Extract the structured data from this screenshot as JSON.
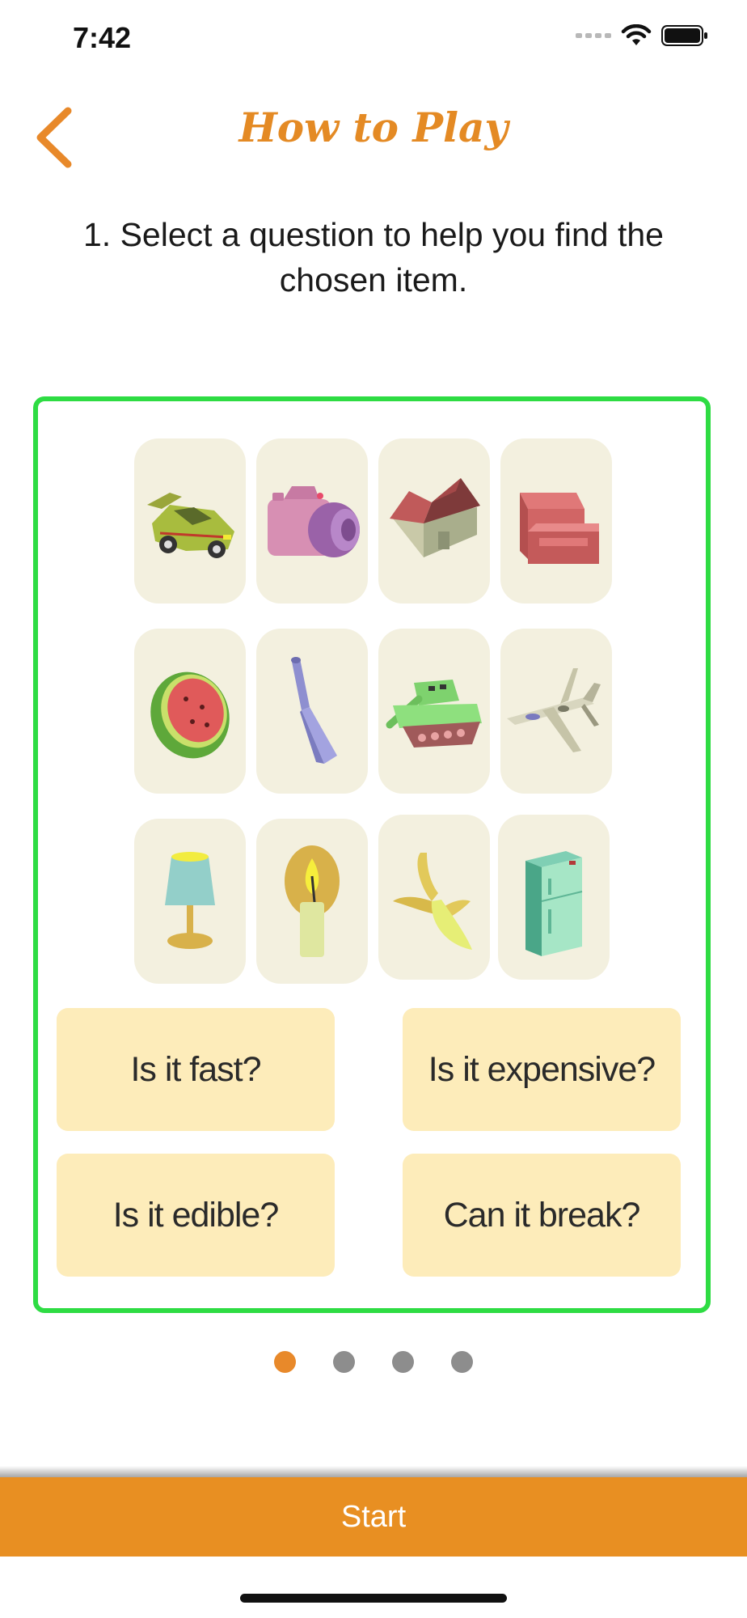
{
  "status_bar": {
    "time": "7:42",
    "icons": [
      "signal-icon",
      "wifi-icon",
      "battery-icon"
    ]
  },
  "header": {
    "title": "How to Play",
    "back_icon": "chevron-left-icon"
  },
  "instruction": "1. Select a question to help you find the chosen item.",
  "example": {
    "items": [
      {
        "name": "car"
      },
      {
        "name": "camera"
      },
      {
        "name": "house"
      },
      {
        "name": "armchair"
      },
      {
        "name": "watermelon"
      },
      {
        "name": "bottle"
      },
      {
        "name": "tank"
      },
      {
        "name": "airplane"
      },
      {
        "name": "lamp"
      },
      {
        "name": "candle"
      },
      {
        "name": "banana"
      },
      {
        "name": "refrigerator"
      }
    ],
    "questions": [
      "Is it fast?",
      "Is it expensive?",
      "Is it edible?",
      "Can it break?"
    ]
  },
  "pagination": {
    "total": 4,
    "active": 1
  },
  "start_label": "Start",
  "colors": {
    "accent": "#E88F22",
    "panel_border": "#2EDC43",
    "question_bg": "#FDECBA",
    "card_bg": "#F3F0DF"
  }
}
